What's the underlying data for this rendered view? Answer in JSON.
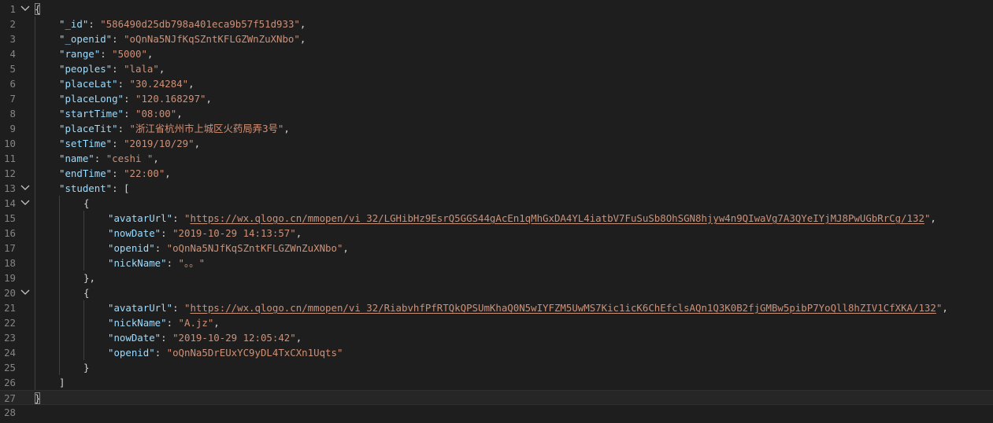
{
  "editor": {
    "lines": [
      {
        "n": "1",
        "fold": true,
        "indent": 0,
        "tokens": [
          {
            "t": "p",
            "v": "{",
            "hl": true
          }
        ]
      },
      {
        "n": "2",
        "indent": 1,
        "tokens": [
          {
            "t": "k",
            "v": "\"_id\""
          },
          {
            "t": "p",
            "v": ": "
          },
          {
            "t": "s",
            "v": "\"586490d25db798a401eca9b57f51d933\""
          },
          {
            "t": "p",
            "v": ","
          }
        ]
      },
      {
        "n": "3",
        "indent": 1,
        "tokens": [
          {
            "t": "k",
            "v": "\"_openid\""
          },
          {
            "t": "p",
            "v": ": "
          },
          {
            "t": "s",
            "v": "\"oQnNa5NJfKqSZntKFLGZWnZuXNbo\""
          },
          {
            "t": "p",
            "v": ","
          }
        ]
      },
      {
        "n": "4",
        "indent": 1,
        "tokens": [
          {
            "t": "k",
            "v": "\"range\""
          },
          {
            "t": "p",
            "v": ": "
          },
          {
            "t": "s",
            "v": "\"5000\""
          },
          {
            "t": "p",
            "v": ","
          }
        ]
      },
      {
        "n": "5",
        "indent": 1,
        "tokens": [
          {
            "t": "k",
            "v": "\"peoples\""
          },
          {
            "t": "p",
            "v": ": "
          },
          {
            "t": "s",
            "v": "\"lala\""
          },
          {
            "t": "p",
            "v": ","
          }
        ]
      },
      {
        "n": "6",
        "indent": 1,
        "tokens": [
          {
            "t": "k",
            "v": "\"placeLat\""
          },
          {
            "t": "p",
            "v": ": "
          },
          {
            "t": "s",
            "v": "\"30.24284\""
          },
          {
            "t": "p",
            "v": ","
          }
        ]
      },
      {
        "n": "7",
        "indent": 1,
        "tokens": [
          {
            "t": "k",
            "v": "\"placeLong\""
          },
          {
            "t": "p",
            "v": ": "
          },
          {
            "t": "s",
            "v": "\"120.168297\""
          },
          {
            "t": "p",
            "v": ","
          }
        ]
      },
      {
        "n": "8",
        "indent": 1,
        "tokens": [
          {
            "t": "k",
            "v": "\"startTime\""
          },
          {
            "t": "p",
            "v": ": "
          },
          {
            "t": "s",
            "v": "\"08:00\""
          },
          {
            "t": "p",
            "v": ","
          }
        ]
      },
      {
        "n": "9",
        "indent": 1,
        "tokens": [
          {
            "t": "k",
            "v": "\"placeTit\""
          },
          {
            "t": "p",
            "v": ": "
          },
          {
            "t": "s",
            "v": "\"浙江省杭州市上城区火药局弄3号\""
          },
          {
            "t": "p",
            "v": ","
          }
        ]
      },
      {
        "n": "10",
        "indent": 1,
        "tokens": [
          {
            "t": "k",
            "v": "\"setTime\""
          },
          {
            "t": "p",
            "v": ": "
          },
          {
            "t": "s",
            "v": "\"2019/10/29\""
          },
          {
            "t": "p",
            "v": ","
          }
        ]
      },
      {
        "n": "11",
        "indent": 1,
        "tokens": [
          {
            "t": "k",
            "v": "\"name\""
          },
          {
            "t": "p",
            "v": ": "
          },
          {
            "t": "s",
            "v": "\"ceshi \""
          },
          {
            "t": "p",
            "v": ","
          }
        ]
      },
      {
        "n": "12",
        "indent": 1,
        "tokens": [
          {
            "t": "k",
            "v": "\"endTime\""
          },
          {
            "t": "p",
            "v": ": "
          },
          {
            "t": "s",
            "v": "\"22:00\""
          },
          {
            "t": "p",
            "v": ","
          }
        ]
      },
      {
        "n": "13",
        "fold": true,
        "indent": 1,
        "tokens": [
          {
            "t": "k",
            "v": "\"student\""
          },
          {
            "t": "p",
            "v": ": ["
          }
        ]
      },
      {
        "n": "14",
        "fold": true,
        "indent": 2,
        "tokens": [
          {
            "t": "p",
            "v": "{"
          }
        ]
      },
      {
        "n": "15",
        "indent": 3,
        "tokens": [
          {
            "t": "k",
            "v": "\"avatarUrl\""
          },
          {
            "t": "p",
            "v": ": "
          },
          {
            "t": "s",
            "v": "\""
          },
          {
            "t": "u",
            "v": "https://wx.qlogo.cn/mmopen/vi_32/LGHibHz9EsrQ5GGS44gAcEn1qMhGxDA4YL4iatbV7FuSuSb8OhSGN8hjyw4n9QIwaVg7A3QYeIYjMJ8PwUGbRrCg/132"
          },
          {
            "t": "s",
            "v": "\""
          },
          {
            "t": "p",
            "v": ","
          }
        ]
      },
      {
        "n": "16",
        "indent": 3,
        "tokens": [
          {
            "t": "k",
            "v": "\"nowDate\""
          },
          {
            "t": "p",
            "v": ": "
          },
          {
            "t": "s",
            "v": "\"2019-10-29 14:13:57\""
          },
          {
            "t": "p",
            "v": ","
          }
        ]
      },
      {
        "n": "17",
        "indent": 3,
        "tokens": [
          {
            "t": "k",
            "v": "\"openid\""
          },
          {
            "t": "p",
            "v": ": "
          },
          {
            "t": "s",
            "v": "\"oQnNa5NJfKqSZntKFLGZWnZuXNbo\""
          },
          {
            "t": "p",
            "v": ","
          }
        ]
      },
      {
        "n": "18",
        "indent": 3,
        "tokens": [
          {
            "t": "k",
            "v": "\"nickName\""
          },
          {
            "t": "p",
            "v": ": "
          },
          {
            "t": "s",
            "v": "\"。。\""
          }
        ]
      },
      {
        "n": "19",
        "indent": 2,
        "tokens": [
          {
            "t": "p",
            "v": "},"
          }
        ]
      },
      {
        "n": "20",
        "fold": true,
        "indent": 2,
        "tokens": [
          {
            "t": "p",
            "v": "{"
          }
        ]
      },
      {
        "n": "21",
        "indent": 3,
        "tokens": [
          {
            "t": "k",
            "v": "\"avatarUrl\""
          },
          {
            "t": "p",
            "v": ": "
          },
          {
            "t": "s",
            "v": "\""
          },
          {
            "t": "u",
            "v": "https://wx.qlogo.cn/mmopen/vi_32/RiabvhfPfRTQkQPSUmKhaQ0N5wIYFZM5UwMS7Kic1icK6ChEfclsAQn1Q3K0B2fjGMBw5pibP7YoQll8hZIV1CfXKA/132"
          },
          {
            "t": "s",
            "v": "\""
          },
          {
            "t": "p",
            "v": ","
          }
        ]
      },
      {
        "n": "22",
        "indent": 3,
        "tokens": [
          {
            "t": "k",
            "v": "\"nickName\""
          },
          {
            "t": "p",
            "v": ": "
          },
          {
            "t": "s",
            "v": "\"A.jz\""
          },
          {
            "t": "p",
            "v": ","
          }
        ]
      },
      {
        "n": "23",
        "indent": 3,
        "tokens": [
          {
            "t": "k",
            "v": "\"nowDate\""
          },
          {
            "t": "p",
            "v": ": "
          },
          {
            "t": "s",
            "v": "\"2019-10-29 12:05:42\""
          },
          {
            "t": "p",
            "v": ","
          }
        ]
      },
      {
        "n": "24",
        "indent": 3,
        "tokens": [
          {
            "t": "k",
            "v": "\"openid\""
          },
          {
            "t": "p",
            "v": ": "
          },
          {
            "t": "s",
            "v": "\"oQnNa5DrEUxYC9yDL4TxCXn1Uqts\""
          }
        ]
      },
      {
        "n": "25",
        "indent": 2,
        "tokens": [
          {
            "t": "p",
            "v": "}"
          }
        ]
      },
      {
        "n": "26",
        "indent": 1,
        "tokens": [
          {
            "t": "p",
            "v": "]"
          }
        ]
      },
      {
        "n": "27",
        "indent": 0,
        "current": true,
        "tokens": [
          {
            "t": "p",
            "v": "}",
            "hl": true
          }
        ]
      },
      {
        "n": "28",
        "indent": 0,
        "tokens": []
      }
    ],
    "fold_icon": "chevron-down-icon",
    "colors": {
      "background": "#1e1e1e",
      "line_number": "#858585",
      "key": "#9cdcfe",
      "string": "#ce9178",
      "punctuation": "#d4d4d4",
      "indent_guide": "#404040"
    }
  }
}
